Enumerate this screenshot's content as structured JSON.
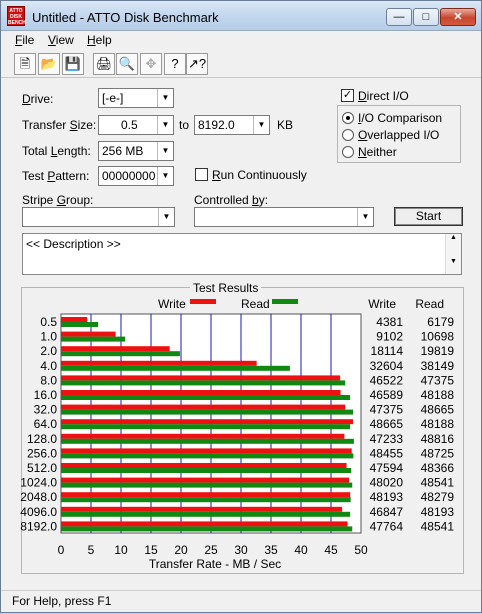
{
  "window": {
    "title": "Untitled - ATTO Disk Benchmark",
    "app_icon_text": "ATTO DISK BENCH"
  },
  "menu": [
    "File",
    "View",
    "Help"
  ],
  "toolbar": [
    "new-icon",
    "open-icon",
    "save-icon",
    "print-icon",
    "print-preview-icon",
    "move-icon",
    "help-icon",
    "context-help-icon"
  ],
  "form": {
    "drive_label": "Drive:",
    "drive_value": "[-e-]",
    "transfer_size_label": "Transfer Size:",
    "transfer_from": "0.5",
    "transfer_to_label": "to",
    "transfer_to": "8192.0",
    "transfer_unit": "KB",
    "total_length_label": "Total Length:",
    "total_length_value": "256 MB",
    "test_pattern_label": "Test Pattern:",
    "test_pattern_value": "00000000",
    "run_continuously_label": "Run Continuously",
    "run_continuously_checked": false,
    "stripe_group_label": "Stripe Group:",
    "stripe_group_value": "",
    "controlled_by_label": "Controlled by:",
    "controlled_by_value": "",
    "direct_io_label": "Direct I/O",
    "direct_io_checked": true,
    "io_options": [
      "I/O Comparison",
      "Overlapped I/O",
      "Neither"
    ],
    "io_selected": 0,
    "start_label": "Start",
    "description": "<< Description >>"
  },
  "status": "For Help, press F1",
  "colors": {
    "write": "#ee1111",
    "read": "#118811",
    "grid": "#1a1ab0"
  },
  "chart_data": {
    "type": "bar",
    "title": "Test Results",
    "categories": [
      "0.5",
      "1.0",
      "2.0",
      "4.0",
      "8.0",
      "16.0",
      "32.0",
      "64.0",
      "128.0",
      "256.0",
      "512.0",
      "1024.0",
      "2048.0",
      "4096.0",
      "8192.0"
    ],
    "series": [
      {
        "name": "Write",
        "values": [
          4381,
          9102,
          18114,
          32604,
          46522,
          46589,
          47375,
          48665,
          47233,
          48455,
          47594,
          48020,
          48193,
          46847,
          47764
        ]
      },
      {
        "name": "Read",
        "values": [
          6179,
          10698,
          19819,
          38149,
          47375,
          48188,
          48665,
          48188,
          48816,
          48725,
          48366,
          48541,
          48279,
          48193,
          48541
        ]
      }
    ],
    "xlabel": "Transfer Rate - MB / Sec",
    "xlim": [
      0,
      50
    ],
    "xticks": [
      "0",
      "5",
      "10",
      "15",
      "20",
      "25",
      "30",
      "35",
      "40",
      "45",
      "50"
    ],
    "table_headers": [
      "Write",
      "Read"
    ],
    "orientation": "horizontal",
    "grid": true
  }
}
